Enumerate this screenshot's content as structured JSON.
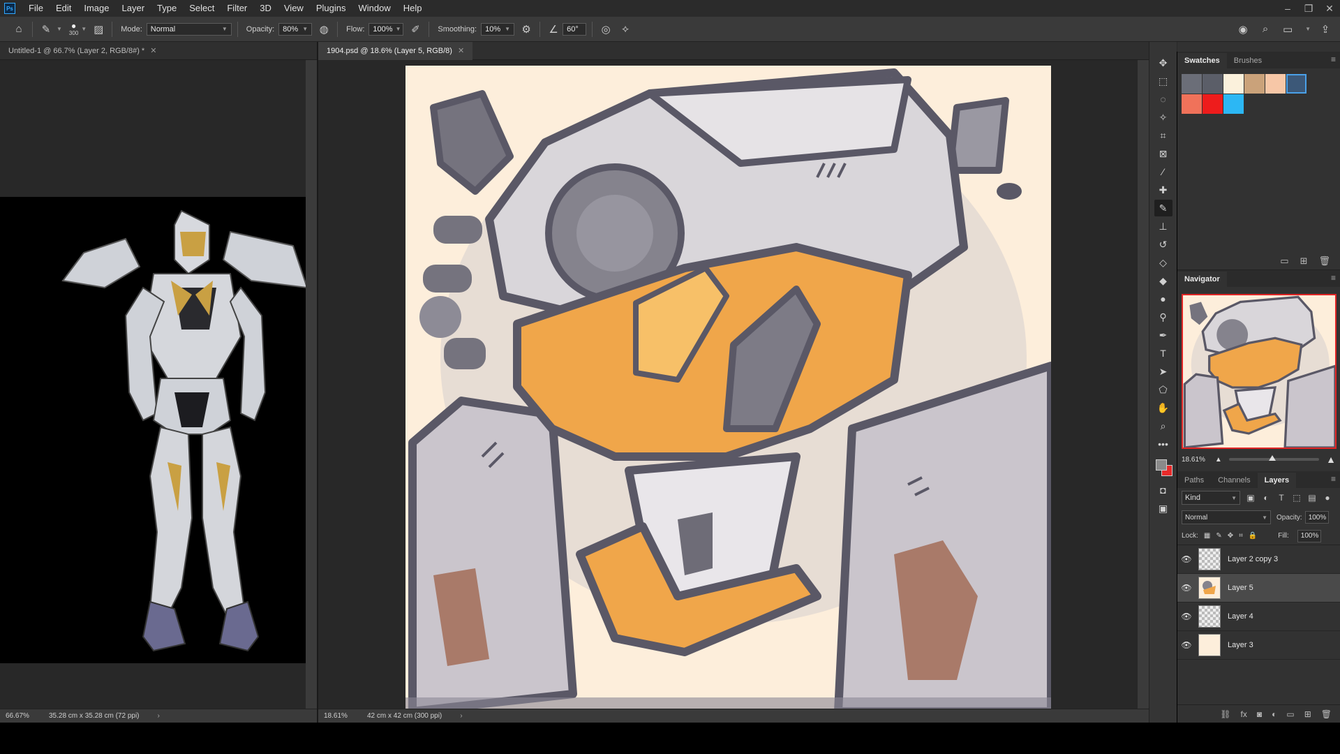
{
  "app": {
    "logo": "Ps",
    "menu": [
      "File",
      "Edit",
      "Image",
      "Layer",
      "Type",
      "Select",
      "Filter",
      "3D",
      "View",
      "Plugins",
      "Window",
      "Help"
    ]
  },
  "options": {
    "brush_size": "300",
    "mode_label": "Mode:",
    "mode_value": "Normal",
    "opacity_label": "Opacity:",
    "opacity_value": "80%",
    "flow_label": "Flow:",
    "flow_value": "100%",
    "smoothing_label": "Smoothing:",
    "smoothing_value": "10%",
    "angle_value": "60°"
  },
  "docs": {
    "left": {
      "tab_title": "Untitled-1 @ 66.7% (Layer 2, RGB/8#) *",
      "zoom": "66.67%",
      "size": "35.28 cm x 35.28 cm (72 ppi)"
    },
    "right": {
      "tab_title": "1904.psd @ 18.6% (Layer 5, RGB/8)",
      "zoom": "18.61%",
      "size": "42 cm x 42 cm (300 ppi)"
    }
  },
  "swatches_panel": {
    "tabs": [
      "Swatches",
      "Brushes"
    ],
    "colors": [
      "#6b6e78",
      "#5b5e68",
      "#fbf1dc",
      "#caa27a",
      "#f7c7a7",
      "#3c5878",
      "#f0725a",
      "#ee1c1c",
      "#2cb7f4"
    ],
    "selected_index": 5
  },
  "navigator": {
    "title": "Navigator",
    "zoom": "18.61%"
  },
  "layers_panel": {
    "tabs": [
      "Paths",
      "Channels",
      "Layers"
    ],
    "kind_label": "Kind",
    "blend_mode": "Normal",
    "opacity_label": "Opacity:",
    "opacity_value": "100%",
    "lock_label": "Lock:",
    "fill_label": "Fill:",
    "fill_value": "100%",
    "layers": [
      {
        "name": "Layer 2 copy 3",
        "selected": false
      },
      {
        "name": "Layer 5",
        "selected": true
      },
      {
        "name": "Layer 4",
        "selected": false
      },
      {
        "name": "Layer 3",
        "selected": false
      }
    ]
  },
  "colors": {
    "canvas_bg": "#fdeedb",
    "foreground": "#8a8a8a",
    "background": "#e82a2a",
    "accent": "#4aa0e8"
  }
}
